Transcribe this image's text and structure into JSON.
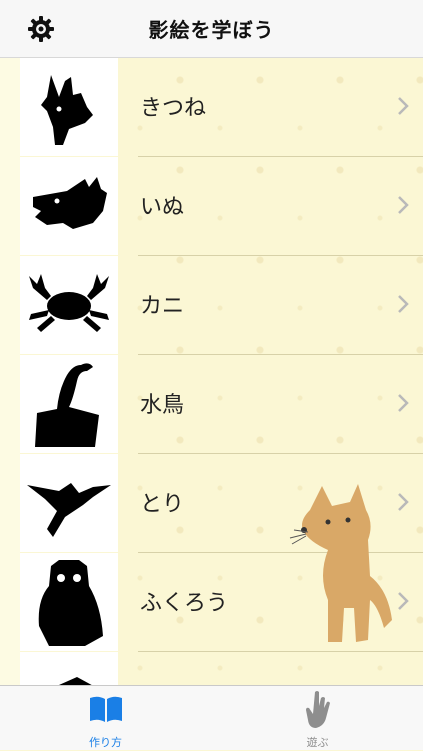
{
  "navbar": {
    "title": "影絵を学ぼう"
  },
  "list": {
    "items": [
      {
        "label": "きつね"
      },
      {
        "label": "いぬ"
      },
      {
        "label": "カニ"
      },
      {
        "label": "水鳥"
      },
      {
        "label": "とり"
      },
      {
        "label": "ふくろう"
      }
    ]
  },
  "tabbar": {
    "tabs": [
      {
        "label": "作り方",
        "icon": "open-book-icon"
      },
      {
        "label": "遊ぶ",
        "icon": "hand-icon"
      }
    ]
  },
  "colors": {
    "accent": "#1a7fe6",
    "background": "#fbf7d4",
    "silhouette": "#000000"
  }
}
